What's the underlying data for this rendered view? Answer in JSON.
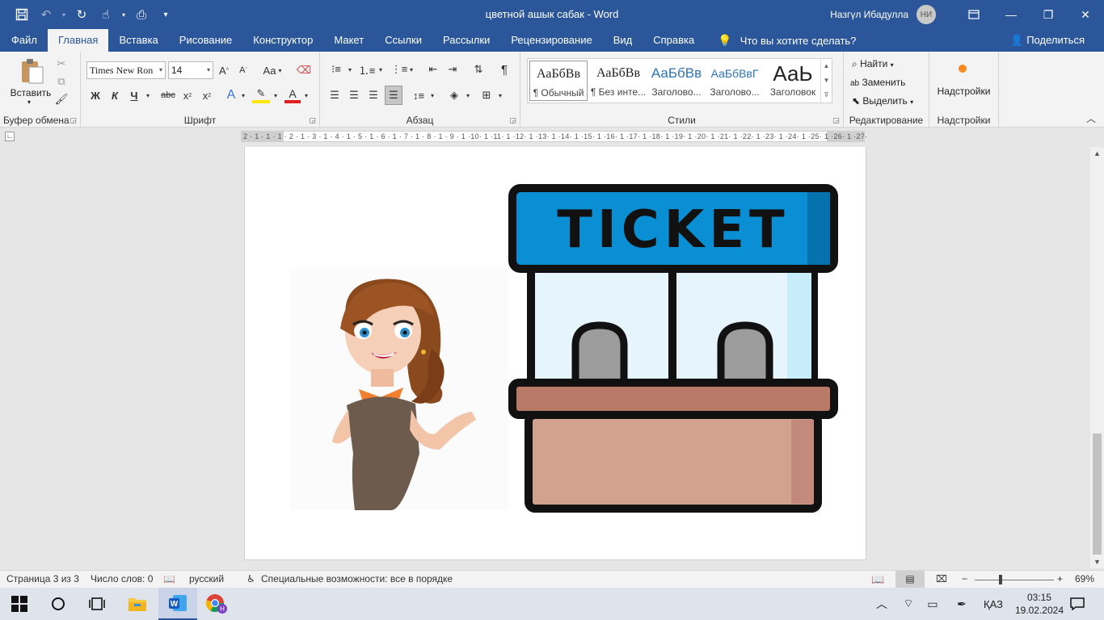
{
  "window": {
    "title": "цветной ашык сабак  -  Word",
    "user_name": "Назгүл Ибадулла",
    "user_initials": "НИ"
  },
  "tabs": [
    {
      "label": "Файл"
    },
    {
      "label": "Главная"
    },
    {
      "label": "Вставка"
    },
    {
      "label": "Рисование"
    },
    {
      "label": "Конструктор"
    },
    {
      "label": "Макет"
    },
    {
      "label": "Ссылки"
    },
    {
      "label": "Рассылки"
    },
    {
      "label": "Рецензирование"
    },
    {
      "label": "Вид"
    },
    {
      "label": "Справка"
    }
  ],
  "tell_me": "Что вы хотите сделать?",
  "share_label": "Поделиться",
  "ribbon": {
    "clipboard": {
      "paste_label": "Вставить",
      "group_label": "Буфер обмена"
    },
    "font": {
      "font_name": "Times New Ron",
      "font_size": "14",
      "group_label": "Шрифт",
      "change_case": "Aa",
      "bold": "Ж",
      "italic": "К",
      "underline": "Ч",
      "strike": "abc"
    },
    "paragraph": {
      "group_label": "Абзац"
    },
    "styles": {
      "group_label": "Стили",
      "items": [
        {
          "preview": "АаБбВв",
          "name": "¶ Обычный"
        },
        {
          "preview": "АаБбВв",
          "name": "¶ Без инте..."
        },
        {
          "preview": "АаБбВв",
          "name": "Заголово..."
        },
        {
          "preview": "АаБбВвГ",
          "name": "Заголово..."
        },
        {
          "preview": "АаЬ",
          "name": "Заголовок"
        }
      ]
    },
    "editing": {
      "group_label": "Редактирование",
      "find": "Найти",
      "replace": "Заменить",
      "select": "Выделить"
    },
    "addins": {
      "label": "Надстройки",
      "group_label": "Надстройки"
    }
  },
  "ruler": {
    "numbers": "2 · 1 · 1 · 1 · 2 · 1 · 3 · 1 · 4 · 1 · 5 · 1 · 6 · 1 · 7 · 1 · 8 · 1 · 9 · 1 ·10· 1 ·11· 1 ·12· 1 ·13· 1 ·14· 1 ·15· 1 ·16· 1 ·17· 1 ·18· 1 ·19· 1 ·20· 1 ·21· 1 ·22· 1 ·23· 1 ·24· 1 ·25· 1 ·26· 1 ·27·"
  },
  "document": {
    "sign_text": "TICKET"
  },
  "status": {
    "page": "Страница 3 из 3",
    "words": "Число слов: 0",
    "language": "русский",
    "accessibility": "Специальные возможности: все в порядке",
    "zoom": "69%"
  },
  "taskbar": {
    "language": "ҚАЗ",
    "time": "03:15",
    "date": "19.02.2024"
  },
  "colors": {
    "word_blue": "#2b579a",
    "ticket_blue": "#0a8fd4",
    "counter": "#b87a66",
    "counter_front": "#d3a28f"
  }
}
